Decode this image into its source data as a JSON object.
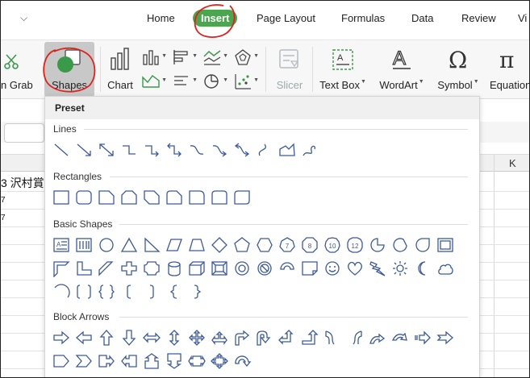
{
  "menu": {
    "tabs": [
      {
        "label": "Home"
      },
      {
        "label": "Insert",
        "active": true
      },
      {
        "label": "Page Layout"
      },
      {
        "label": "Formulas"
      },
      {
        "label": "Data"
      },
      {
        "label": "Review"
      },
      {
        "label": "Vi"
      }
    ]
  },
  "ribbon": {
    "screen_grab": "n Grab",
    "shapes": "Shapes",
    "chart": "Chart",
    "slicer": "Slicer",
    "text_box": "Text Box",
    "wordart": "WordArt",
    "symbol": "Symbol",
    "equation": "Equation"
  },
  "sheet": {
    "col_k": "K",
    "cell_text": "3 沢村賞",
    "row2": "7",
    "row3": "7"
  },
  "dropdown": {
    "header": "Preset",
    "sections": {
      "lines": "Lines",
      "rectangles": "Rectangles",
      "basic": "Basic Shapes",
      "block_arrows": "Block Arrows"
    }
  },
  "colors": {
    "accent": "#4aa64f",
    "shape_stroke": "#3c5a99",
    "annotation": "#e0201b"
  }
}
